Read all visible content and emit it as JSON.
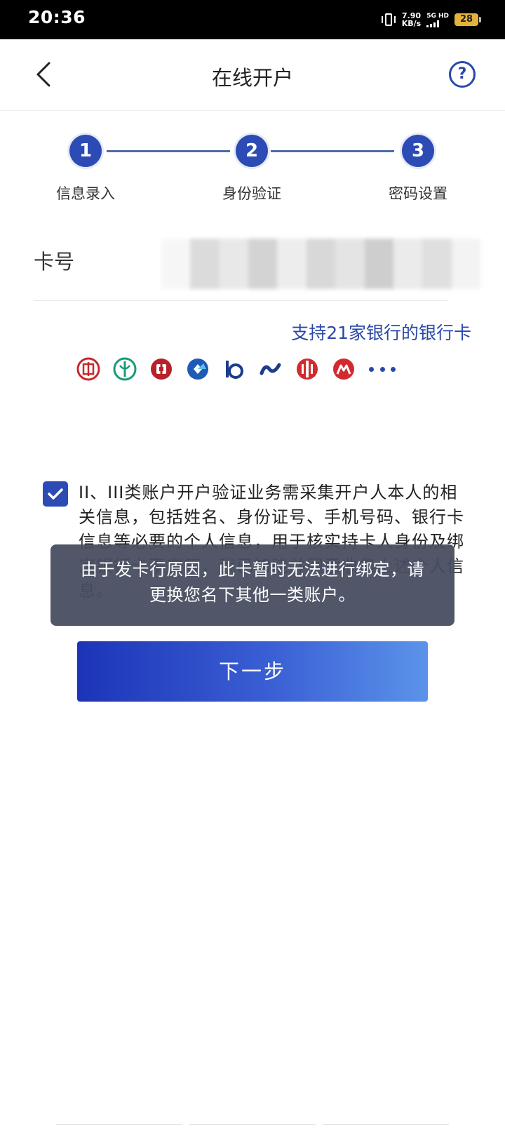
{
  "status_bar": {
    "time": "20:36",
    "speed_value": "7.90",
    "speed_unit": "KB/s",
    "network": "5G HD",
    "battery": "28"
  },
  "nav": {
    "title": "在线开户",
    "help": "?"
  },
  "stepper": {
    "steps": [
      {
        "number": "1",
        "label": "信息录入"
      },
      {
        "number": "2",
        "label": "身份验证"
      },
      {
        "number": "3",
        "label": "密码设置"
      }
    ],
    "current_step": 1
  },
  "card": {
    "label": "卡号",
    "support_text": "支持21家银行的银行卡",
    "bank_icons": [
      "icbc-icon",
      "abc-icon",
      "boc-icon",
      "ccb-icon",
      "bocom-icon",
      "spdb-icon",
      "citic-icon",
      "cmb-icon"
    ]
  },
  "agreement": {
    "checked": true,
    "text": "II、III类账户开户验证业务需采集开户人本人的相关信息，包括姓名、身份证号、手机号码、银行卡信息等必要的个人信息，用于核实持卡人身份及绑定银行卡事宜等，我已知晓并同意收集上述个人信息。"
  },
  "toast": {
    "message": "由于发卡行原因，此卡暂时无法进行绑定，请更换您名下其他一类账户。"
  },
  "buttons": {
    "next_label": "下一步"
  },
  "colors": {
    "primary": "#2d4bb5",
    "link": "#2a48a8",
    "toast_bg": "#484e60"
  }
}
